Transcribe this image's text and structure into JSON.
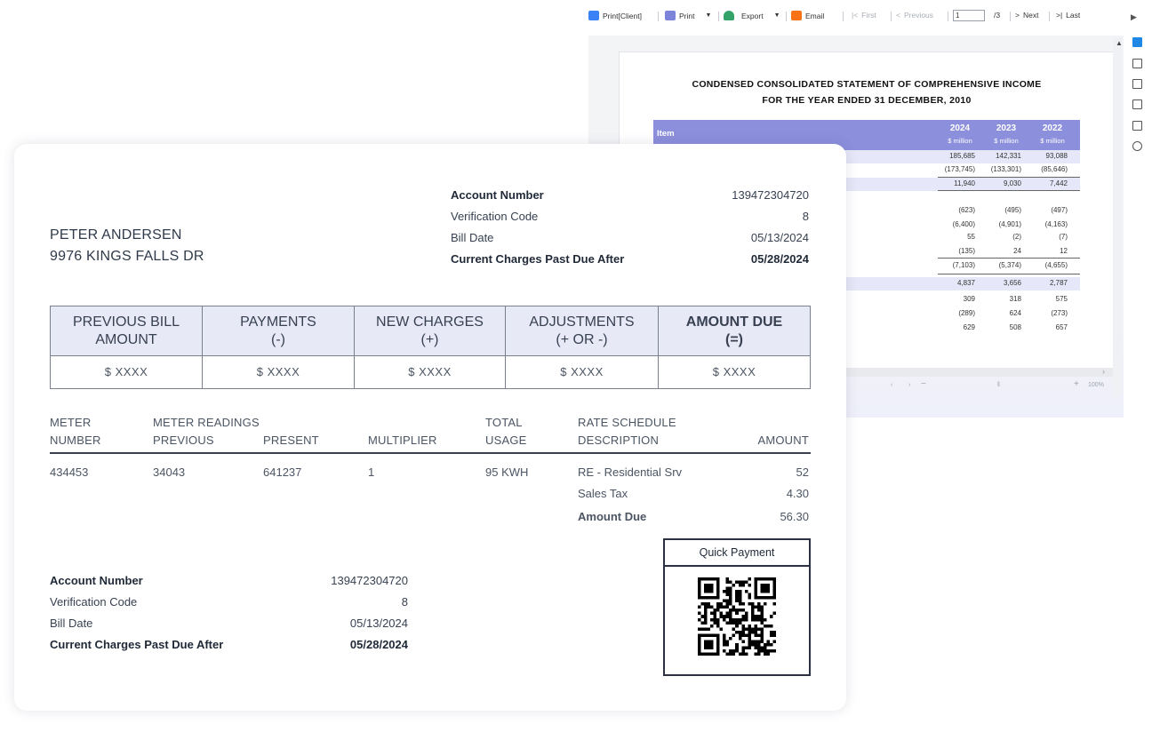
{
  "viewer": {
    "toolbar": {
      "print_client": "Print[Client]",
      "print": "Print",
      "export": "Export",
      "email": "Email",
      "first": "First",
      "previous": "Previous",
      "page_value": "1",
      "page_total": "/3",
      "next": "Next",
      "last": "Last"
    },
    "zoom": "100%",
    "report": {
      "title_line1": "CONDENSED CONSOLIDATED STATEMENT OF COMPREHENSIVE INCOME",
      "title_line2": "FOR THE YEAR ENDED 31 DECEMBER, 2010",
      "header": {
        "item": "Item",
        "years": [
          "2024",
          "2023",
          "2022"
        ],
        "unit": "$ million"
      },
      "rows": [
        [
          "185,685",
          "142,331",
          "93,088"
        ],
        [
          "(173,745)",
          "(133,301)",
          "(85,646)"
        ],
        [
          "11,940",
          "9,030",
          "7,442"
        ],
        [
          "(623)",
          "(495)",
          "(497)"
        ],
        [
          "(6,400)",
          "(4,901)",
          "(4,163)"
        ],
        [
          "55",
          "(2)",
          "(7)"
        ],
        [
          "(135)",
          "24",
          "12"
        ],
        [
          "(7,103)",
          "(5,374)",
          "(4,655)"
        ],
        [
          "4,837",
          "3,656",
          "2,787"
        ],
        [
          "309",
          "318",
          "575"
        ],
        [
          "(289)",
          "624",
          "(273)"
        ],
        [
          "629",
          "508",
          "657"
        ]
      ]
    },
    "colors": {
      "header": "#8c8fdb",
      "shade": "#e6e7f8",
      "accent": "#1e88e5"
    }
  },
  "bill": {
    "customer": {
      "name": "PETER ANDERSEN",
      "address": "9976 KINGS FALLS DR"
    },
    "account_top": {
      "account_number_label": "Account Number",
      "account_number": "139472304720",
      "verification_label": "Verification Code",
      "verification": "8",
      "bill_date_label": "Bill Date",
      "bill_date": "05/13/2024",
      "past_due_label": "Current Charges Past Due After",
      "past_due": "05/28/2024"
    },
    "summary": [
      {
        "line1": "PREVIOUS BILL",
        "line2": "AMOUNT",
        "value": "$  XXXX"
      },
      {
        "line1": "PAYMENTS",
        "line2": "(-)",
        "value": "$  XXXX"
      },
      {
        "line1": "NEW CHARGES",
        "line2": "(+)",
        "value": "$  XXXX"
      },
      {
        "line1": "ADJUSTMENTS",
        "line2": "(+ OR -)",
        "value": "$  XXXX"
      },
      {
        "line1": "AMOUNT DUE",
        "line2": "(=)",
        "value": "$  XXXX"
      }
    ],
    "meter": {
      "headers": {
        "meter_1": "METER",
        "meter_2": "NUMBER",
        "readings_1": "METER READINGS",
        "previous": "PREVIOUS",
        "present": "PRESENT",
        "multiplier": "MULTIPLIER",
        "usage_1": "TOTAL",
        "usage_2": "USAGE",
        "rate_1": "RATE SCHEDULE",
        "rate_2": "DESCRIPTION",
        "amount": "AMOUNT"
      },
      "row": {
        "number": "434453",
        "previous": "34043",
        "present": "641237",
        "multiplier": "1",
        "usage": "95 KWH"
      },
      "charges": [
        {
          "desc": "RE - Residential Srv",
          "amount": "52"
        },
        {
          "desc": "Sales Tax",
          "amount": "4.30"
        }
      ],
      "total_label": "Amount Due",
      "total": "56.30"
    },
    "account_bottom": {
      "account_number_label": "Account Number",
      "account_number": "139472304720",
      "verification_label": "Verification Code",
      "verification": "8",
      "bill_date_label": "Bill Date",
      "bill_date": "05/13/2024",
      "past_due_label": "Current Charges Past Due After",
      "past_due": "05/28/2024"
    },
    "quick_payment": "Quick Payment"
  }
}
